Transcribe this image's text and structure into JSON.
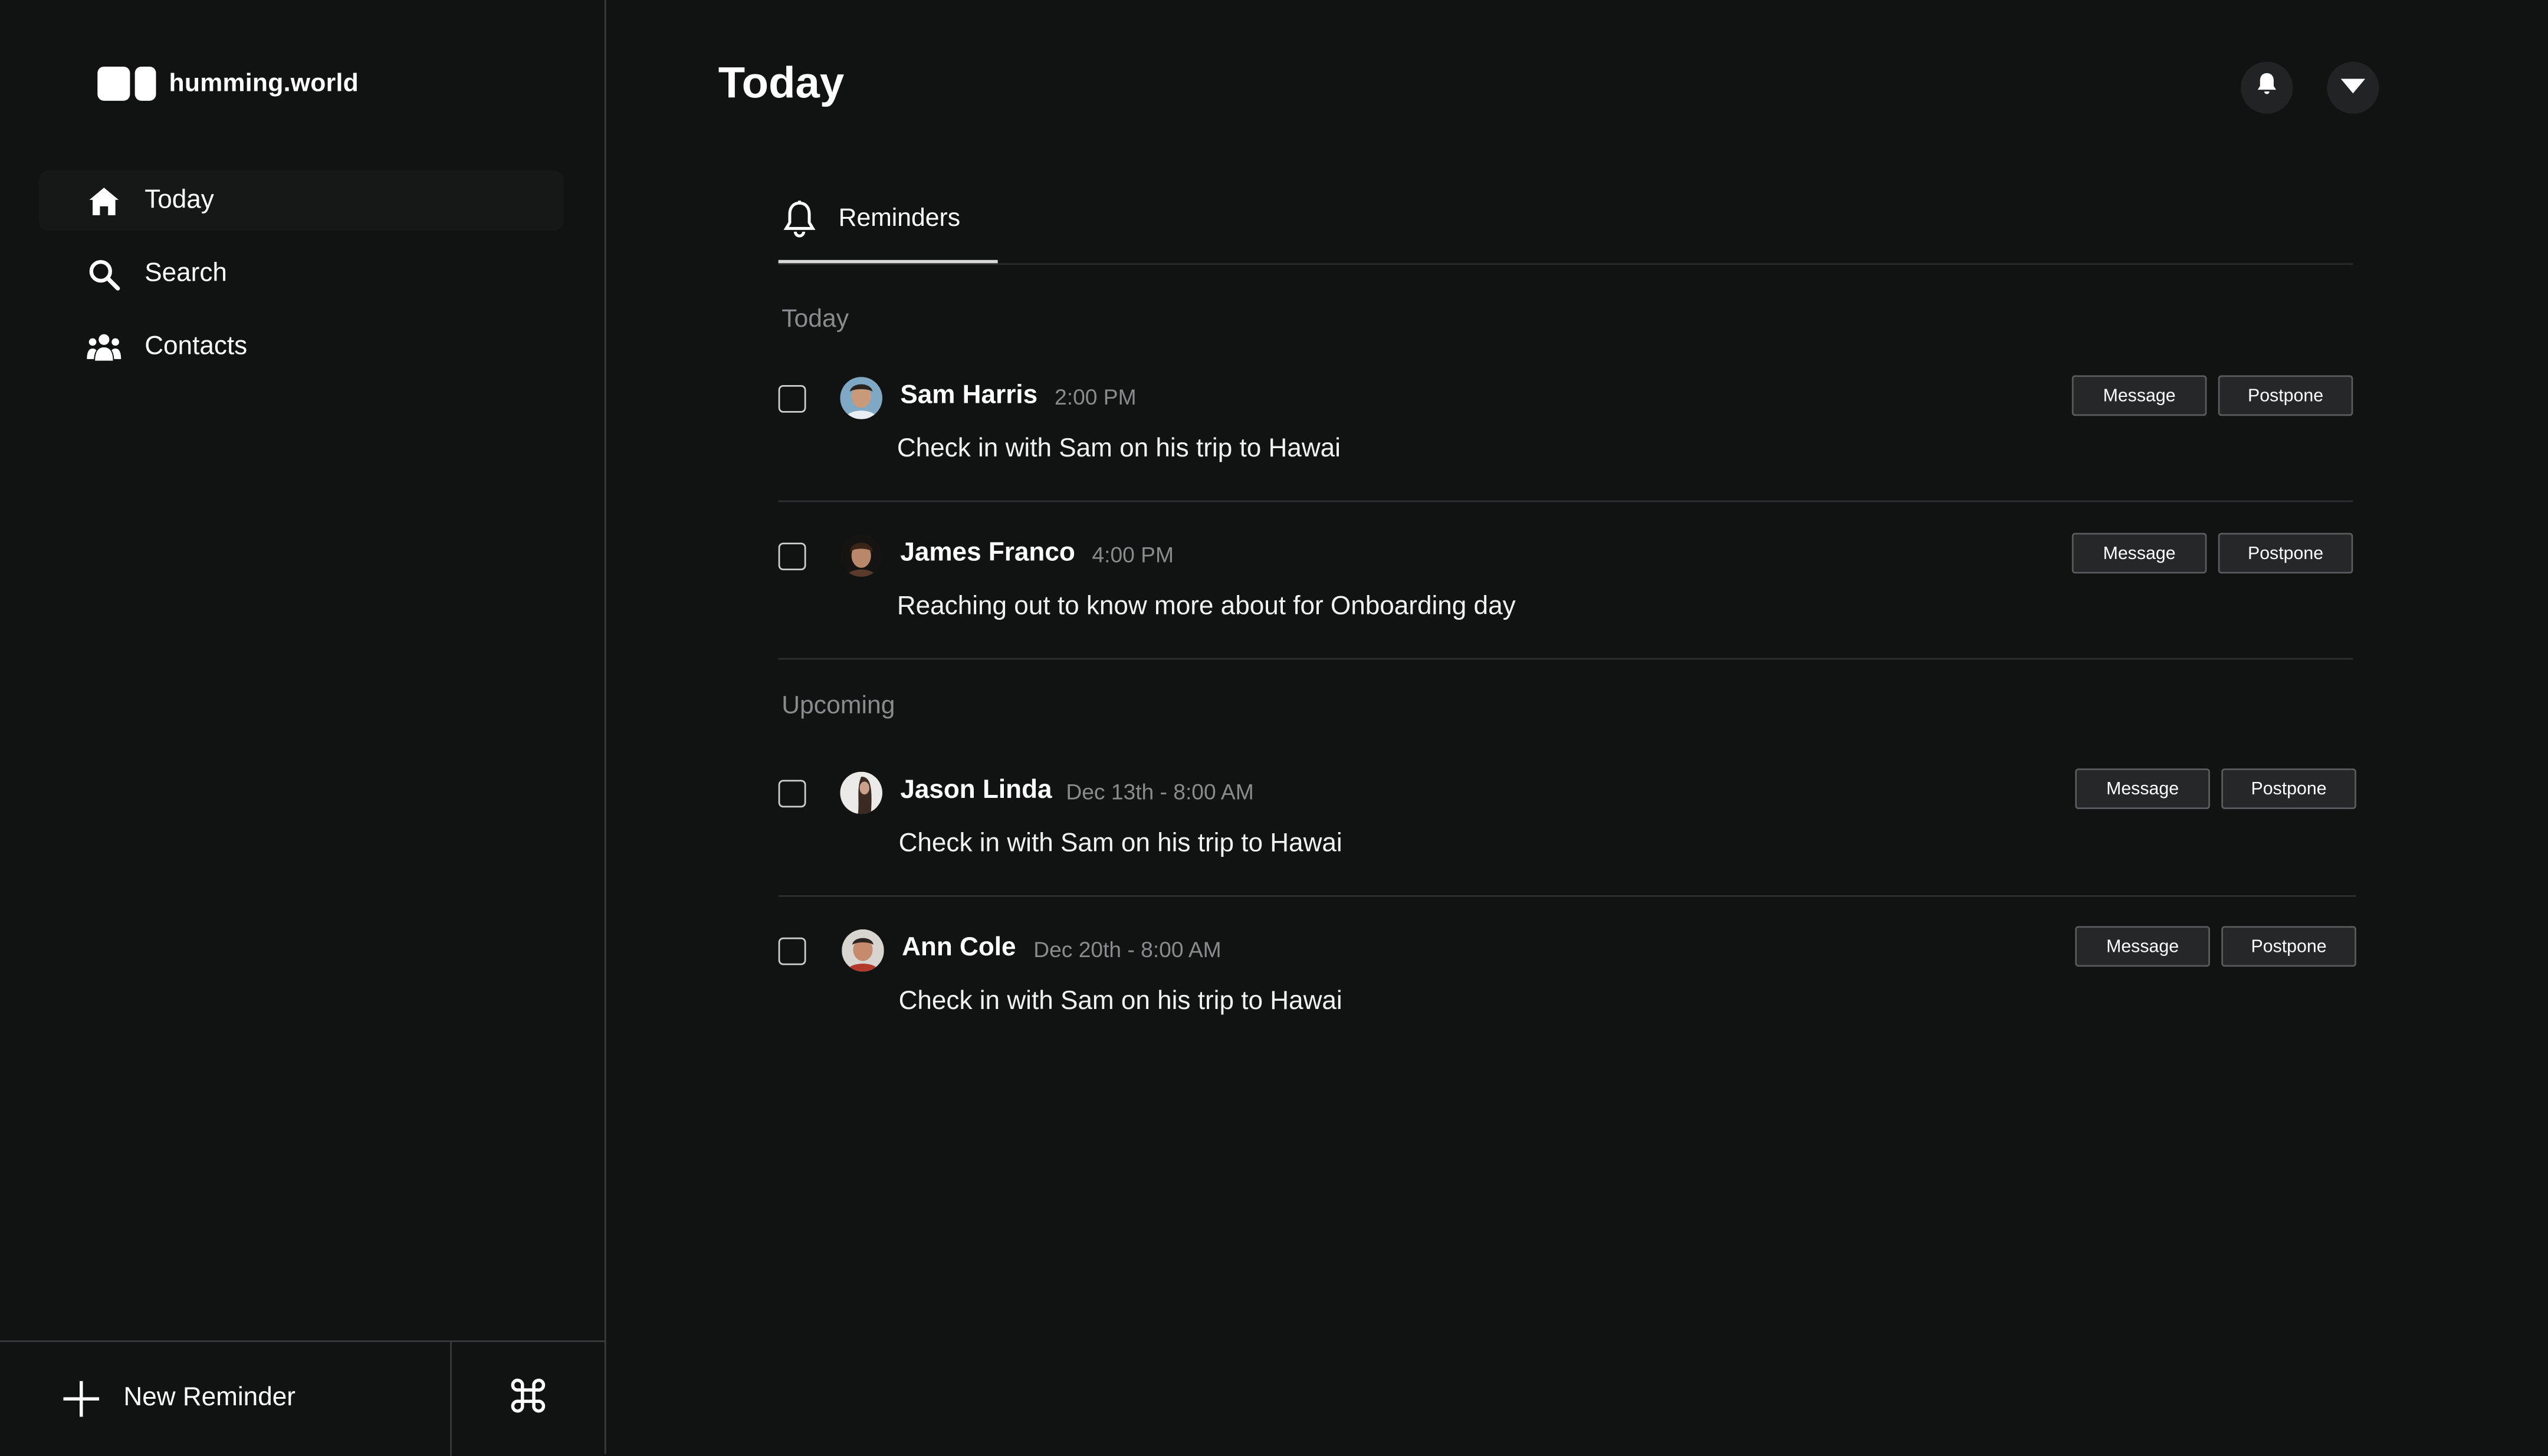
{
  "app": {
    "name": "humming.world"
  },
  "sidebar": {
    "items": [
      {
        "label": "Today",
        "icon": "home-icon",
        "active": true
      },
      {
        "label": "Search",
        "icon": "search-icon",
        "active": false
      },
      {
        "label": "Contacts",
        "icon": "contacts-icon",
        "active": false
      }
    ],
    "new_reminder_label": "New Reminder",
    "command_icon": "command-icon"
  },
  "header": {
    "title": "Today",
    "notifications_icon": "bell-icon",
    "menu_icon": "caret-down-icon"
  },
  "tabs": [
    {
      "label": "Reminders",
      "icon": "bell-outline-icon"
    }
  ],
  "sections": [
    {
      "label": "Today",
      "reminders": [
        {
          "name": "Sam Harris",
          "time": "2:00 PM",
          "note": "Check in with Sam on his trip to Hawai",
          "message_label": "Message",
          "postpone_label": "Postpone"
        },
        {
          "name": "James Franco",
          "time": "4:00 PM",
          "note": "Reaching out to know more about for Onboarding day",
          "message_label": "Message",
          "postpone_label": "Postpone"
        }
      ]
    },
    {
      "label": "Upcoming",
      "reminders": [
        {
          "name": "Jason Linda",
          "time": "Dec 13th - 8:00 AM",
          "note": "Check in with Sam on his trip to Hawai",
          "message_label": "Message",
          "postpone_label": "Postpone"
        },
        {
          "name": "Ann Cole",
          "time": "Dec 20th - 8:00 AM",
          "note": "Check in with Sam on his trip to Hawai",
          "message_label": "Message",
          "postpone_label": "Postpone"
        }
      ]
    }
  ],
  "colors": {
    "background": "#111212",
    "divider": "#3a3b3c",
    "muted_text": "#8a8b8c",
    "button_bg": "#262728"
  }
}
